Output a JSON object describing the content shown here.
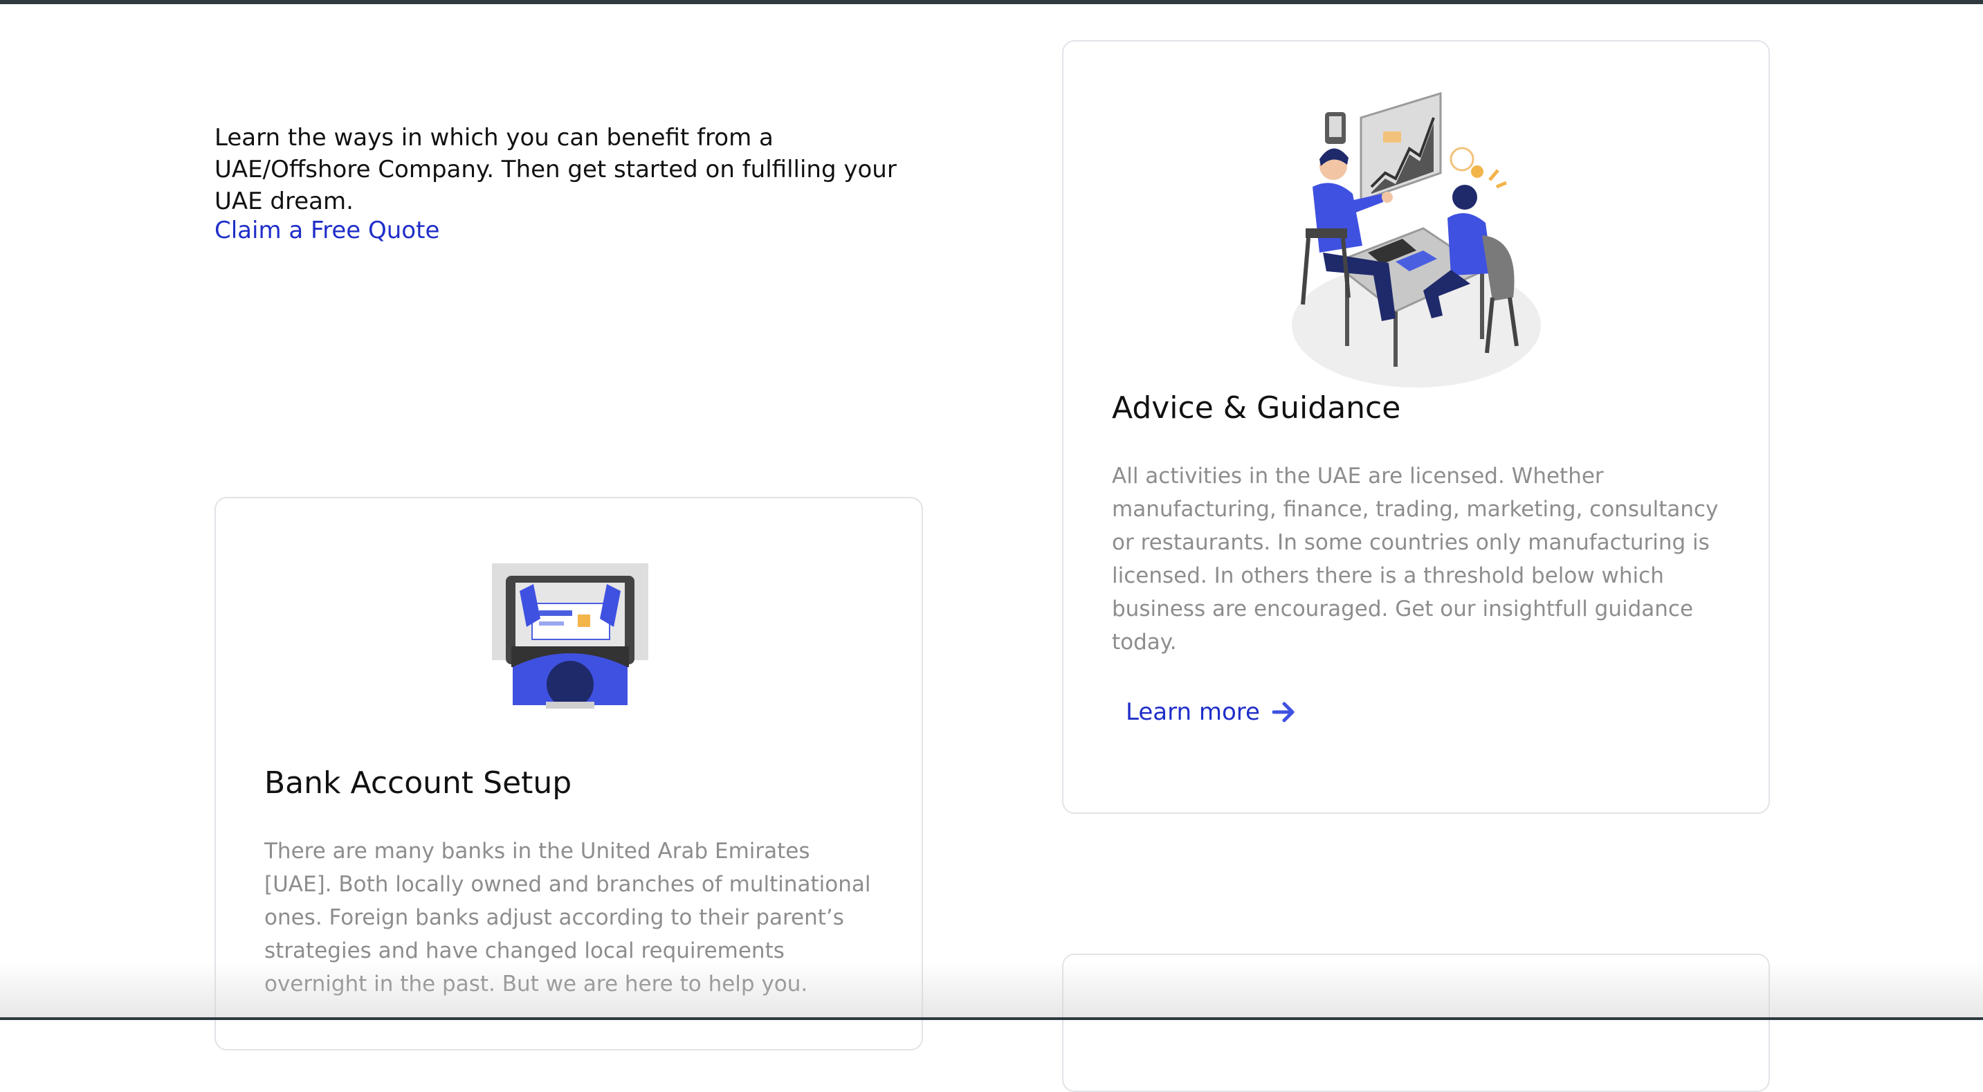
{
  "intro": {
    "text": "Learn the ways in which you can benefit from a UAE/Offshore Company. Then get started on fulfilling your UAE dream.",
    "cta_label": "Claim a Free Quote"
  },
  "cards": [
    {
      "title": "Advice & Guidance",
      "description": "All activities in the UAE are licensed. Whether manufacturing, finance, trading, marketing, consultancy or restaurants. In some countries only manufacturing is licensed. In others there is a threshold below which business are encouraged. Get our insightfull guidance today.",
      "link_label": "Learn more",
      "illustration": "meeting-illustration"
    },
    {
      "title": "Bank Account Setup",
      "description": "There are many banks in the United Arab Emirates [UAE]. Both locally owned and branches of multinational ones. Foreign banks adjust according to their parent’s strategies and have changed local requirements overnight in the past. But we are here to help you.",
      "illustration": "laptop-user-illustration"
    }
  ],
  "icons": {
    "link_arrow": "arrow-right-icon"
  },
  "colors": {
    "link": "#1f2ec9",
    "accent_blue": "#3f51e0",
    "body_text": "#8d8d8d",
    "heading": "#111111",
    "card_border": "#e2e3e8"
  }
}
